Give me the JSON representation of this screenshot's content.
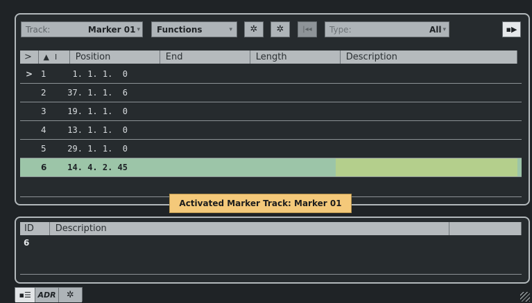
{
  "toolbar": {
    "track_label": "Track:",
    "track_value": "Marker 01",
    "functions_label": "Functions",
    "type_label": "Type:",
    "type_value": "All",
    "icons": [
      "settings-icon",
      "gear-icon",
      "locate-start-icon",
      "swap-view-icon"
    ]
  },
  "marker_table": {
    "columns": {
      "expand": ">",
      "sort": "▲",
      "sort_marker": "I",
      "position": "Position",
      "end": "End",
      "length": "Length",
      "description": "Description"
    },
    "rows": [
      {
        "cursor": ">",
        "id": "1",
        "position": "1. 1. 1.  0"
      },
      {
        "cursor": "",
        "id": "2",
        "position": "37. 1. 1.  6"
      },
      {
        "cursor": "",
        "id": "3",
        "position": "19. 1. 1.  0"
      },
      {
        "cursor": "",
        "id": "4",
        "position": "13. 1. 1.  0"
      },
      {
        "cursor": "",
        "id": "5",
        "position": "29. 1. 1.  0"
      },
      {
        "cursor": "",
        "id": "6",
        "position": "14. 4. 2. 45"
      }
    ],
    "selected_id": "6"
  },
  "tooltip": {
    "text": "Activated Marker Track: Marker 01"
  },
  "detail_table": {
    "columns": {
      "id": "ID",
      "description": "Description"
    },
    "value_id": "6"
  },
  "bottom_bar": {
    "list_label": "",
    "adr_label": "ADR"
  },
  "colors": {
    "selection": "#9cc5a8",
    "selection_desc": "#b4cf8c",
    "tooltip": "#f4c97a"
  }
}
